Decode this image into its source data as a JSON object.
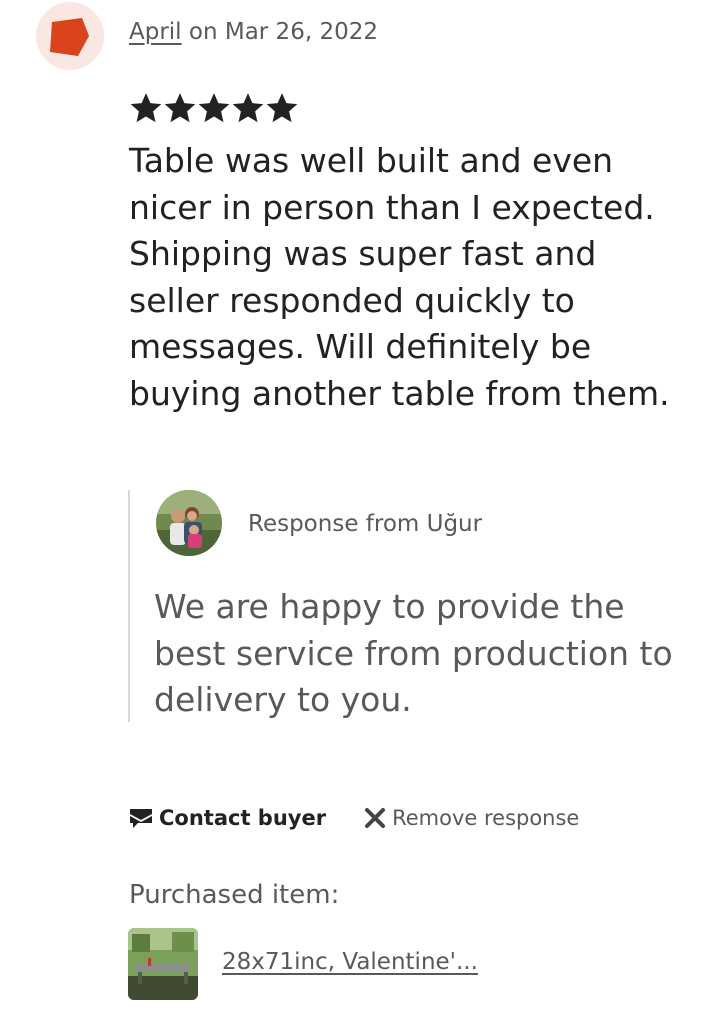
{
  "review": {
    "reviewer_name": "April",
    "date_text": " on Mar 26, 2022",
    "rating": 5,
    "rating_max": 5,
    "text": "Table was well built and even nicer in person than I expected. Shipping was super fast and seller responded quickly to messages. Will definitely be buying another table from them."
  },
  "response": {
    "label": "Response from Uğur",
    "text": "We are happy to provide the best service from production to delivery to you."
  },
  "actions": {
    "contact_label": "Contact buyer",
    "remove_label": "Remove response"
  },
  "purchased": {
    "label": "Purchased item:",
    "item_title": "28x71inc, Valentine'..."
  },
  "colors": {
    "avatar_bg": "#f8e8e1",
    "avatar_shape": "#d9441c",
    "text_primary": "#222222",
    "text_secondary": "#595959",
    "divider": "#d8d8d8"
  },
  "icons": {
    "avatar": "pentagon-avatar-icon",
    "star": "star-icon",
    "contact": "envelope-icon",
    "remove": "close-icon"
  }
}
